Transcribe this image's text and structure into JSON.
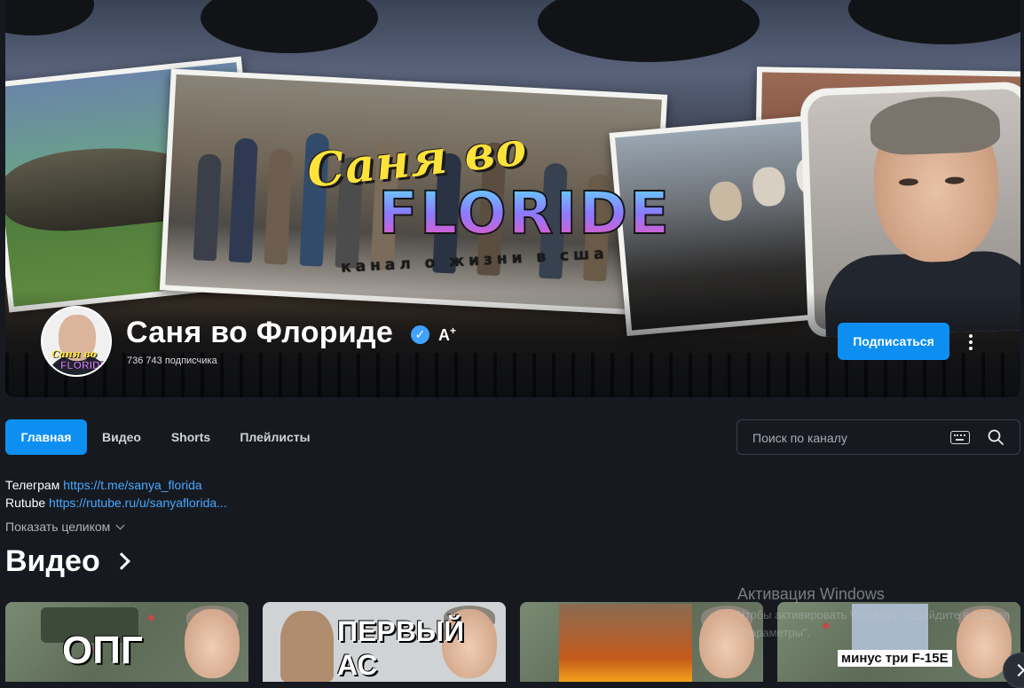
{
  "channel": {
    "name": "Саня во Флориде",
    "subscribers": "736 743 подписчика",
    "subscribe_label": "Подписаться",
    "badge_label": "A",
    "badge_sup": "+"
  },
  "banner": {
    "logo_script": "Саня во",
    "logo_main": "FLORIDE",
    "logo_sub": "канал о жизни в сша"
  },
  "avatar": {
    "line1": "Саня во",
    "line2": "FLORIDE"
  },
  "tabs": [
    {
      "label": "Главная",
      "active": true
    },
    {
      "label": "Видео",
      "active": false
    },
    {
      "label": "Shorts",
      "active": false
    },
    {
      "label": "Плейлисты",
      "active": false
    }
  ],
  "search": {
    "placeholder": "Поиск по каналу"
  },
  "description": {
    "line1_prefix": "Телеграм",
    "line1_link": "https://t.me/sanya_florida",
    "line2_prefix": "Rutube",
    "line2_link": "https://rutube.ru/u/sanyaflorida...",
    "show_more": "Показать целиком"
  },
  "videos_section": {
    "title": "Видео"
  },
  "videos": [
    {
      "caption": "ОПГ"
    },
    {
      "caption": "ПЕРВЫЙ АС"
    },
    {
      "caption": ""
    },
    {
      "caption": "минус три F-15E"
    }
  ],
  "watermark": {
    "title": "Активация Windows",
    "text": "Чтобы активировать Windows, перейдите в раздел \"Параметры\"."
  },
  "colors": {
    "accent": "#0d8ff2",
    "link": "#4aa8ff",
    "background": "#161a20"
  }
}
